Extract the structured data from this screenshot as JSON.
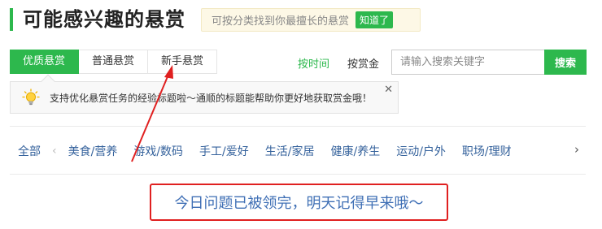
{
  "header": {
    "title": "可能感兴趣的悬赏",
    "hint_text": "可按分类找到你最擅长的悬赏",
    "hint_button": "知道了"
  },
  "tabs": [
    {
      "label": "优质悬赏",
      "active": true
    },
    {
      "label": "普通悬赏",
      "active": false
    },
    {
      "label": "新手悬赏",
      "active": false
    }
  ],
  "sort": {
    "by_time": "按时间",
    "by_reward": "按赏金"
  },
  "search": {
    "placeholder": "请输入搜索关键字",
    "button": "搜索"
  },
  "tip": {
    "text": "支持优化悬赏任务的经验标题啦～通顺的标题能帮助你更好地获取赏金哦！",
    "close_icon": "close-icon",
    "icon": "lightbulb-icon"
  },
  "categories": {
    "all": "全部",
    "items": [
      "美食/营养",
      "游戏/数码",
      "手工/爱好",
      "生活/家居",
      "健康/养生",
      "运动/户外",
      "职场/理财"
    ]
  },
  "empty_message": "今日问题已被领完，明天记得早来哦～",
  "colors": {
    "accent": "#2db84d",
    "link": "#35629c",
    "annotation": "#e02020"
  }
}
